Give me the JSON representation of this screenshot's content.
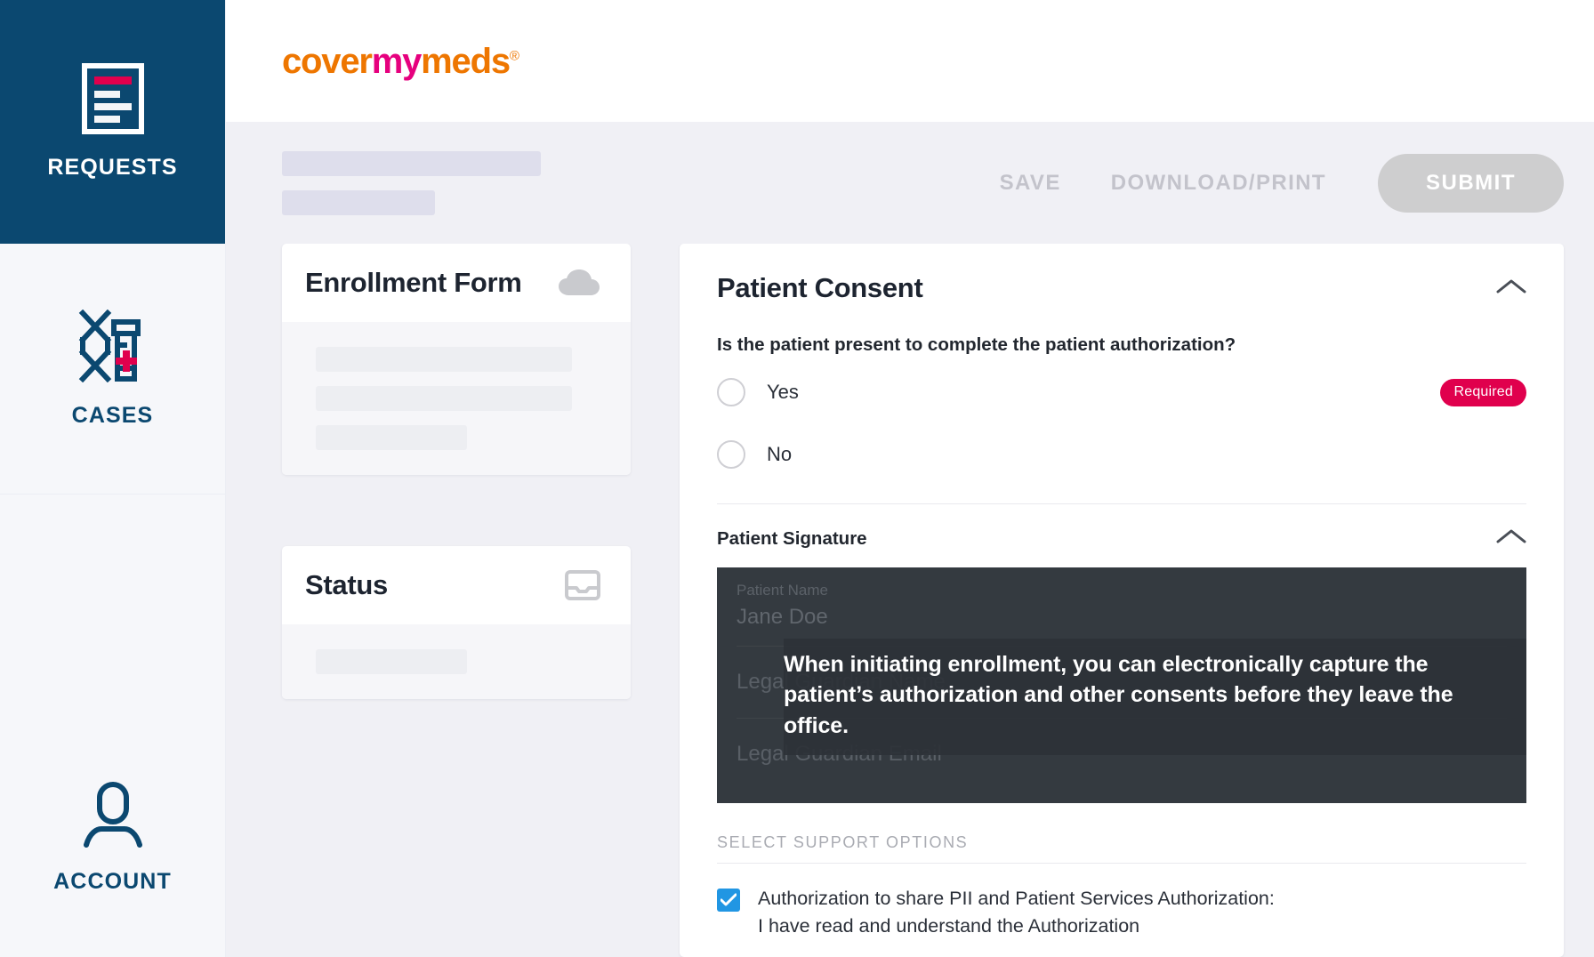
{
  "sidebar": {
    "items": [
      {
        "label": "REQUESTS",
        "icon": "document-icon",
        "active": true
      },
      {
        "label": "CASES",
        "icon": "dna-pill-bottle-icon",
        "active": false
      },
      {
        "label": "ACCOUNT",
        "icon": "person-icon",
        "active": false
      }
    ]
  },
  "header": {
    "logo_part1": "cover",
    "logo_part2": "my",
    "logo_part3": "meds",
    "logo_registered": "®"
  },
  "toolbar": {
    "save_label": "SAVE",
    "download_print_label": "DOWNLOAD/PRINT",
    "submit_label": "SUBMIT"
  },
  "left_column": {
    "enrollment_card": {
      "title": "Enrollment Form",
      "icon": "cloud-icon"
    },
    "status_card": {
      "title": "Status",
      "icon": "inbox-icon"
    }
  },
  "consent": {
    "title": "Patient Consent",
    "collapse_icon": "chevron-up-icon",
    "question": "Is the patient present to complete the patient authorization?",
    "options": [
      {
        "label": "Yes",
        "selected": false
      },
      {
        "label": "No",
        "selected": false
      }
    ],
    "required_badge": "Required",
    "signature_section": {
      "title": "Patient Signature",
      "collapse_icon": "chevron-up-icon",
      "fields": [
        {
          "label": "Patient Name",
          "value": "Jane Doe"
        },
        {
          "label": "",
          "placeholder": "Legal Guardian Name"
        },
        {
          "label": "",
          "placeholder": "Legal Guardian Email"
        }
      ],
      "tooltip": "When initiating enrollment, you can electronically capture the patient’s authorization and other consents before they leave the office."
    },
    "support_options_label": "SELECT SUPPORT OPTIONS",
    "authorization": {
      "checked": true,
      "line1": "Authorization to share PII and Patient Services Authorization:",
      "line2": "I have read and understand the Authorization"
    }
  },
  "colors": {
    "nav_active": "#0b4870",
    "brand_orange": "#ee7600",
    "brand_magenta": "#e6007e",
    "required_badge": "#e0004d",
    "checkbox_blue": "#2196e3",
    "overlay_dark": "#343a40"
  }
}
